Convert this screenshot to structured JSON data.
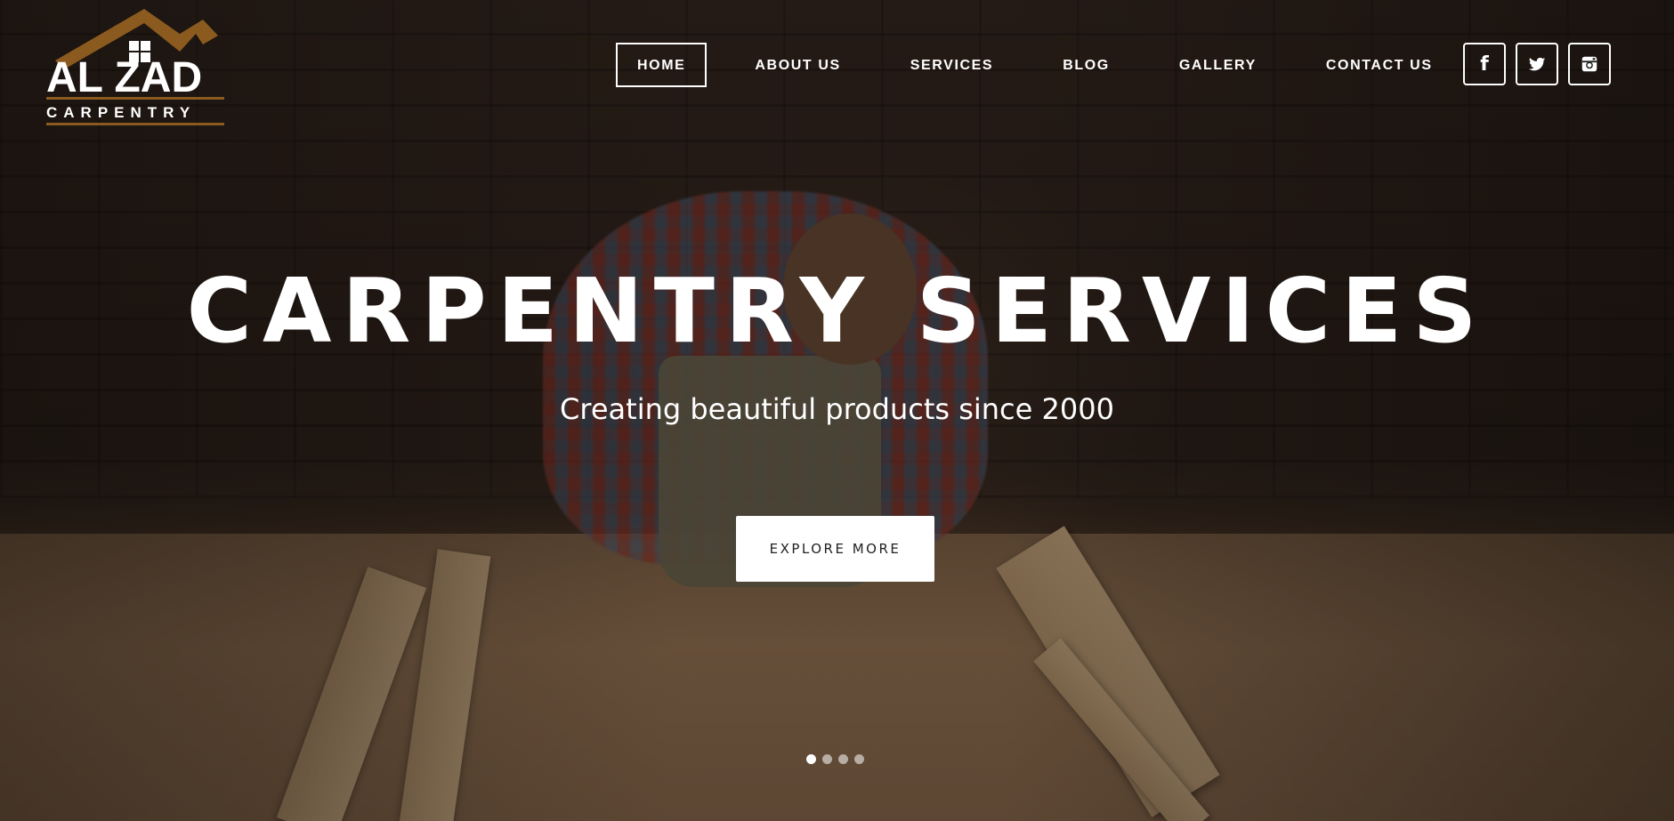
{
  "brand": {
    "name": "AL ZAD",
    "tagline": "CARPENTRY",
    "accent_color": "#8B5A1E"
  },
  "nav": {
    "items": [
      {
        "label": "HOME",
        "active": true
      },
      {
        "label": "ABOUT US",
        "active": false
      },
      {
        "label": "SERVICES",
        "active": false
      },
      {
        "label": "BLOG",
        "active": false
      },
      {
        "label": "GALLERY",
        "active": false
      },
      {
        "label": "CONTACT US",
        "active": false
      }
    ]
  },
  "social": [
    {
      "name": "facebook-icon",
      "glyph": "f"
    },
    {
      "name": "twitter-icon",
      "glyph": "twitter"
    },
    {
      "name": "instagram-icon",
      "glyph": "instagram"
    }
  ],
  "hero": {
    "title": "CARPENTRY SERVICES",
    "subtitle": "Creating beautiful products since 2000",
    "cta_label": "EXPLORE MORE"
  },
  "slider": {
    "slide_count": 4,
    "active_index": 0
  }
}
